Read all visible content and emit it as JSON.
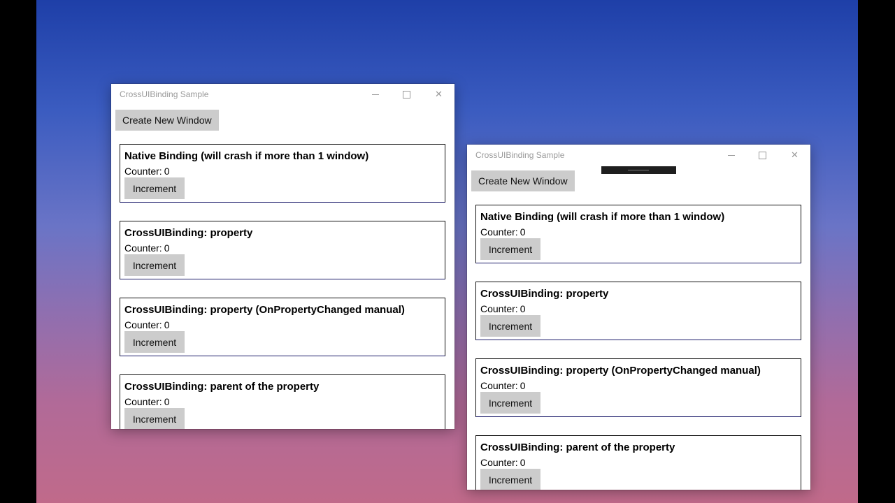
{
  "windows": [
    {
      "title": "CrossUIBinding Sample",
      "create_button": "Create New Window",
      "panels": [
        {
          "title": "Native Binding (will crash if more than 1 window)",
          "counter_label": "Counter:",
          "counter_value": "0",
          "button": "Increment"
        },
        {
          "title": "CrossUIBinding: property",
          "counter_label": "Counter:",
          "counter_value": "0",
          "button": "Increment"
        },
        {
          "title": "CrossUIBinding: property (OnPropertyChanged manual)",
          "counter_label": "Counter:",
          "counter_value": "0",
          "button": "Increment"
        },
        {
          "title": "CrossUIBinding: parent of the property",
          "counter_label": "Counter:",
          "counter_value": "0",
          "button": "Increment"
        }
      ]
    },
    {
      "title": "CrossUIBinding Sample",
      "create_button": "Create New Window",
      "panels": [
        {
          "title": "Native Binding (will crash if more than 1 window)",
          "counter_label": "Counter:",
          "counter_value": "0",
          "button": "Increment"
        },
        {
          "title": "CrossUIBinding: property",
          "counter_label": "Counter:",
          "counter_value": "0",
          "button": "Increment"
        },
        {
          "title": "CrossUIBinding: property (OnPropertyChanged manual)",
          "counter_label": "Counter:",
          "counter_value": "0",
          "button": "Increment"
        },
        {
          "title": "CrossUIBinding: parent of the property",
          "counter_label": "Counter:",
          "counter_value": "0",
          "button": "Increment"
        }
      ]
    }
  ],
  "icons": {
    "minimize": "minimize-icon",
    "maximize": "maximize-icon",
    "close": "close-icon"
  }
}
